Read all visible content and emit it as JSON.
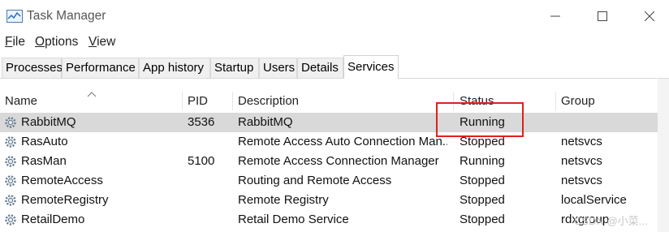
{
  "window": {
    "title": "Task Manager",
    "icon": "task-manager-icon"
  },
  "menu": [
    {
      "mnemonic": "F",
      "rest": "ile"
    },
    {
      "mnemonic": "O",
      "rest": "ptions"
    },
    {
      "mnemonic": "V",
      "rest": "iew"
    }
  ],
  "tabs": [
    {
      "label": "Processes",
      "active": false
    },
    {
      "label": "Performance",
      "active": false
    },
    {
      "label": "App history",
      "active": false
    },
    {
      "label": "Startup",
      "active": false
    },
    {
      "label": "Users",
      "active": false
    },
    {
      "label": "Details",
      "active": false
    },
    {
      "label": "Services",
      "active": true
    }
  ],
  "columns": {
    "name": "Name",
    "pid": "PID",
    "description": "Description",
    "status": "Status",
    "group": "Group"
  },
  "rows": [
    {
      "name": "RabbitMQ",
      "pid": "3536",
      "description": "RabbitMQ",
      "status": "Running",
      "group": "",
      "selected": true
    },
    {
      "name": "RasAuto",
      "pid": "",
      "description": "Remote Access Auto Connection Man...",
      "status": "Stopped",
      "group": "netsvcs",
      "selected": false
    },
    {
      "name": "RasMan",
      "pid": "5100",
      "description": "Remote Access Connection Manager",
      "status": "Running",
      "group": "netsvcs",
      "selected": false
    },
    {
      "name": "RemoteAccess",
      "pid": "",
      "description": "Routing and Remote Access",
      "status": "Stopped",
      "group": "netsvcs",
      "selected": false
    },
    {
      "name": "RemoteRegistry",
      "pid": "",
      "description": "Remote Registry",
      "status": "Stopped",
      "group": "localService",
      "selected": false
    },
    {
      "name": "RetailDemo",
      "pid": "",
      "description": "Retail Demo Service",
      "status": "Stopped",
      "group": "rdxgroup",
      "selected": false
    }
  ],
  "annotation": {
    "color": "#e02020"
  },
  "watermark": "CSDN @小菜..."
}
